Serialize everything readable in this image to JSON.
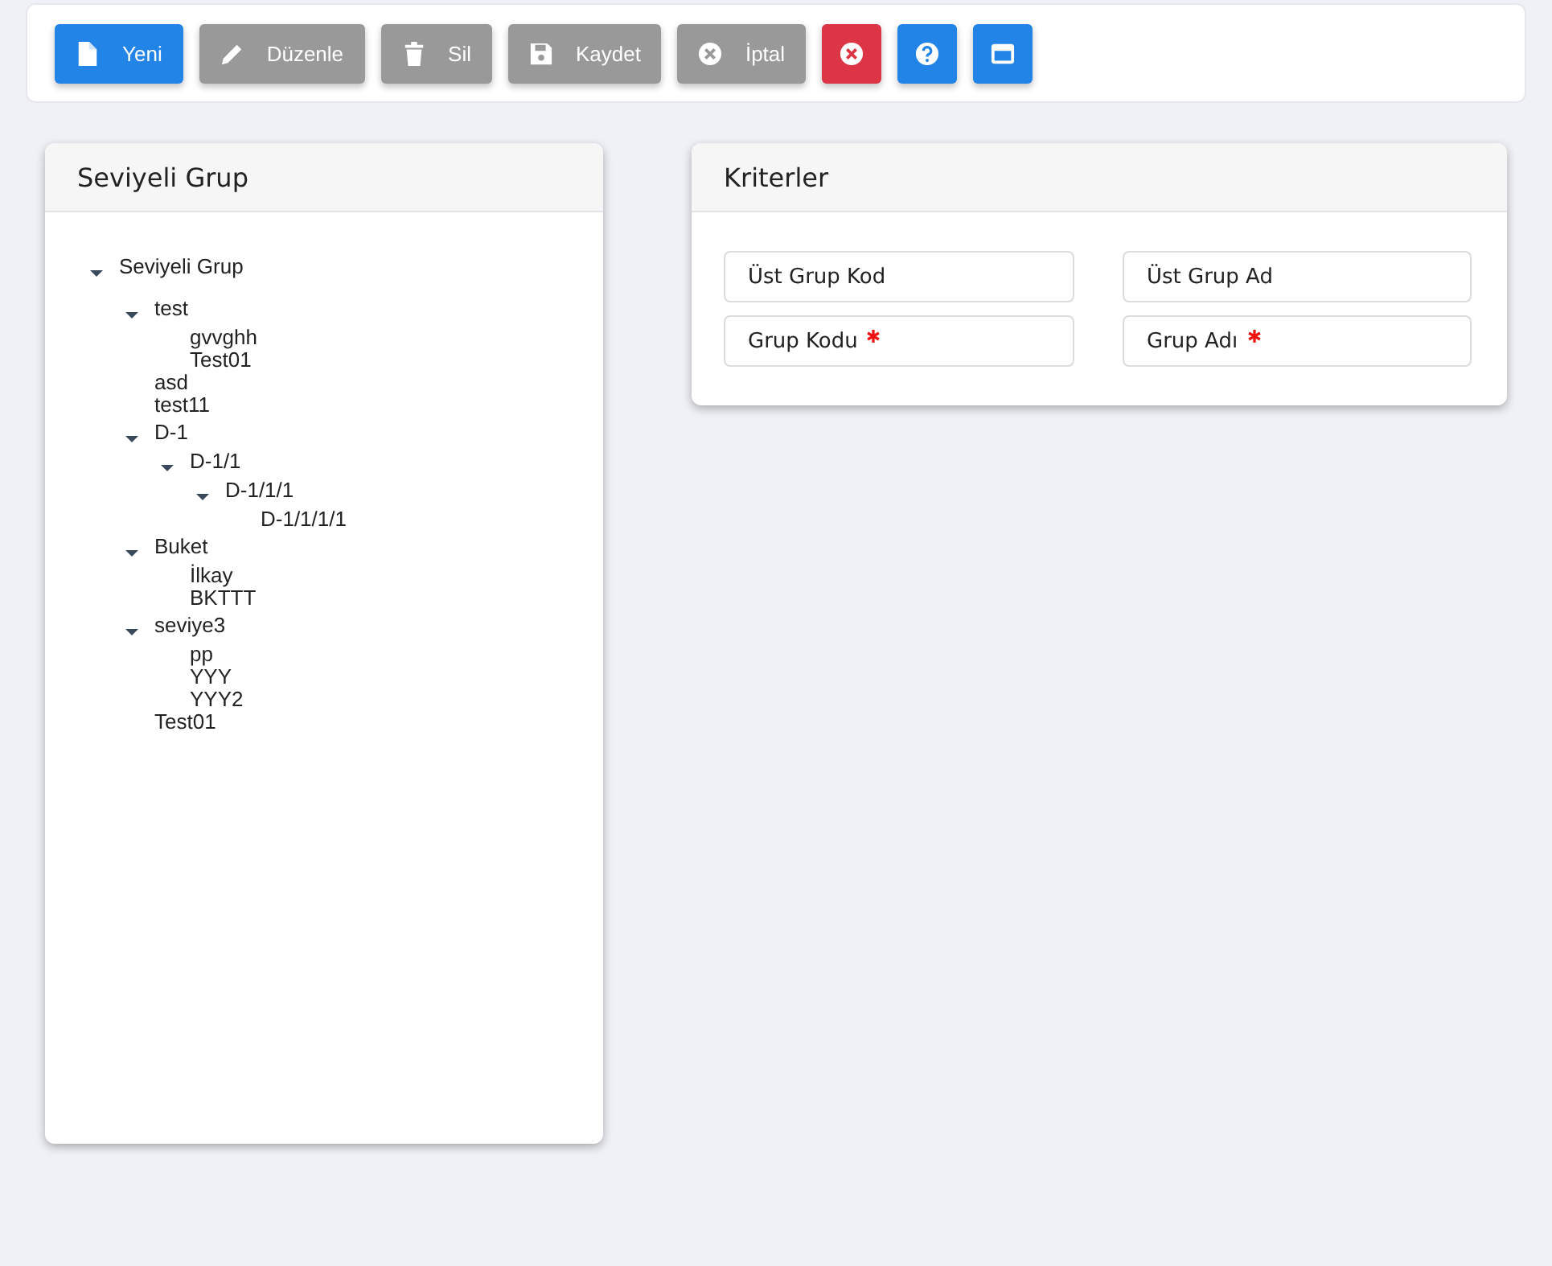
{
  "toolbar": [
    {
      "label": "Yeni",
      "color": "#2384e8"
    },
    {
      "label": "Düzenle",
      "color": "#999999"
    },
    {
      "label": "Sil",
      "color": "#999999"
    },
    {
      "label": "Kaydet",
      "color": "#999999"
    },
    {
      "label": "İptal",
      "color": "#999999"
    },
    {
      "color": "#dc3545"
    },
    {
      "color": "#2384e8"
    },
    {
      "color": "#2384e8"
    }
  ],
  "tree_panel": {
    "title": "Seviyeli Grup",
    "tree": [
      {
        "label": "Seviyeli Grup",
        "expanded": true,
        "children": [
          {
            "label": "test",
            "expanded": true,
            "children": [
              {
                "label": "gvvghh"
              },
              {
                "label": "Test01"
              }
            ]
          },
          {
            "label": "asd"
          },
          {
            "label": "test11"
          },
          {
            "label": "D-1",
            "expanded": true,
            "children": [
              {
                "label": "D-1/1",
                "expanded": true,
                "children": [
                  {
                    "label": "D-1/1/1",
                    "expanded": true,
                    "children": [
                      {
                        "label": "D-1/1/1/1"
                      }
                    ]
                  }
                ]
              }
            ]
          },
          {
            "label": "Buket",
            "expanded": true,
            "children": [
              {
                "label": "İlkay"
              },
              {
                "label": "BKTTT"
              }
            ]
          },
          {
            "label": "seviye3",
            "expanded": true,
            "children": [
              {
                "label": "pp"
              },
              {
                "label": "YYY"
              },
              {
                "label": "YYY2"
              }
            ]
          },
          {
            "label": "Test01"
          }
        ]
      }
    ]
  },
  "criteria_panel": {
    "title": "Kriterler",
    "fields": [
      {
        "placeholder": "Üst Grup Kod",
        "required": false
      },
      {
        "placeholder": "Üst Grup Ad",
        "required": false
      },
      {
        "placeholder": "Grup Kodu",
        "required": true
      },
      {
        "placeholder": "Grup Adı",
        "required": true
      }
    ]
  }
}
